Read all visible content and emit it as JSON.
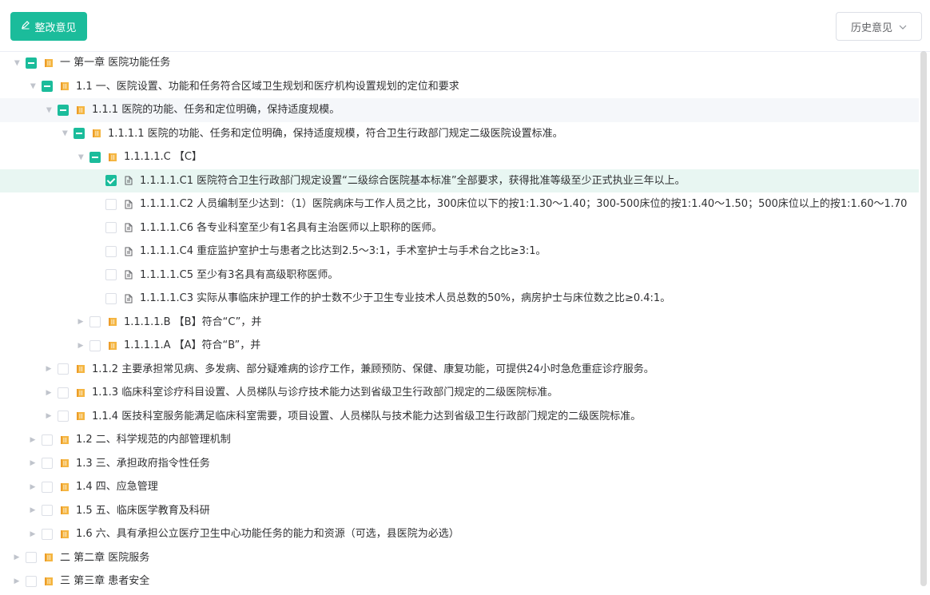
{
  "toolbar": {
    "rectify_label": "整改意见",
    "history_label": "历史意见"
  },
  "colors": {
    "primary": "#1bbc9b",
    "folder": "#f5b642"
  },
  "tree": [
    {
      "depth": 0,
      "caret": "open",
      "check": "ind",
      "icon": "folder",
      "label": "一 第一章 医院功能任务",
      "state": ""
    },
    {
      "depth": 1,
      "caret": "open",
      "check": "ind",
      "icon": "folder",
      "label": "1.1 一、医院设置、功能和任务符合区域卫生规划和医疗机构设置规划的定位和要求",
      "state": ""
    },
    {
      "depth": 2,
      "caret": "open",
      "check": "ind",
      "icon": "folder",
      "label": "1.1.1 医院的功能、任务和定位明确，保持适度规模。",
      "state": "hover"
    },
    {
      "depth": 3,
      "caret": "open",
      "check": "ind",
      "icon": "folder",
      "label": "1.1.1.1 医院的功能、任务和定位明确，保持适度规模，符合卫生行政部门规定二级医院设置标准。",
      "state": ""
    },
    {
      "depth": 4,
      "caret": "open",
      "check": "ind",
      "icon": "folder",
      "label": "1.1.1.1.C 【C】",
      "state": ""
    },
    {
      "depth": 5,
      "caret": "leaf",
      "check": "on",
      "icon": "doc",
      "label": "1.1.1.1.C1 医院符合卫生行政部门规定设置“二级综合医院基本标准”全部要求，获得批准等级至少正式执业三年以上。",
      "state": "current"
    },
    {
      "depth": 5,
      "caret": "leaf",
      "check": "off",
      "icon": "doc",
      "label": "1.1.1.1.C2 人员编制至少达到：（1）医院病床与工作人员之比，300床位以下的按1:1.30～1.40；300-500床位的按1:1.40～1.50；500床位以上的按1:1.60～1.70",
      "state": ""
    },
    {
      "depth": 5,
      "caret": "leaf",
      "check": "off",
      "icon": "doc",
      "label": "1.1.1.1.C6 各专业科室至少有1名具有主治医师以上职称的医师。",
      "state": ""
    },
    {
      "depth": 5,
      "caret": "leaf",
      "check": "off",
      "icon": "doc",
      "label": "1.1.1.1.C4 重症监护室护士与患者之比达到2.5～3:1，手术室护士与手术台之比≥3:1。",
      "state": ""
    },
    {
      "depth": 5,
      "caret": "leaf",
      "check": "off",
      "icon": "doc",
      "label": "1.1.1.1.C5 至少有3名具有高级职称医师。",
      "state": ""
    },
    {
      "depth": 5,
      "caret": "leaf",
      "check": "off",
      "icon": "doc",
      "label": "1.1.1.1.C3 实际从事临床护理工作的护士数不少于卫生专业技术人员总数的50%，病房护士与床位数之比≥0.4:1。",
      "state": ""
    },
    {
      "depth": 4,
      "caret": "closed",
      "check": "off",
      "icon": "folder",
      "label": "1.1.1.1.B 【B】符合“C”，并",
      "state": ""
    },
    {
      "depth": 4,
      "caret": "closed",
      "check": "off",
      "icon": "folder",
      "label": "1.1.1.1.A 【A】符合“B”，并",
      "state": ""
    },
    {
      "depth": 2,
      "caret": "closed",
      "check": "off",
      "icon": "folder",
      "label": "1.1.2 主要承担常见病、多发病、部分疑难病的诊疗工作，兼顾预防、保健、康复功能，可提供24小时急危重症诊疗服务。",
      "state": ""
    },
    {
      "depth": 2,
      "caret": "closed",
      "check": "off",
      "icon": "folder",
      "label": "1.1.3 临床科室诊疗科目设置、人员梯队与诊疗技术能力达到省级卫生行政部门规定的二级医院标准。",
      "state": ""
    },
    {
      "depth": 2,
      "caret": "closed",
      "check": "off",
      "icon": "folder",
      "label": "1.1.4 医技科室服务能满足临床科室需要，项目设置、人员梯队与技术能力达到省级卫生行政部门规定的二级医院标准。",
      "state": ""
    },
    {
      "depth": 1,
      "caret": "closed",
      "check": "off",
      "icon": "folder",
      "label": "1.2 二、科学规范的内部管理机制",
      "state": ""
    },
    {
      "depth": 1,
      "caret": "closed",
      "check": "off",
      "icon": "folder",
      "label": "1.3 三、承担政府指令性任务",
      "state": ""
    },
    {
      "depth": 1,
      "caret": "closed",
      "check": "off",
      "icon": "folder",
      "label": "1.4 四、应急管理",
      "state": ""
    },
    {
      "depth": 1,
      "caret": "closed",
      "check": "off",
      "icon": "folder",
      "label": "1.5 五、临床医学教育及科研",
      "state": ""
    },
    {
      "depth": 1,
      "caret": "closed",
      "check": "off",
      "icon": "folder",
      "label": "1.6 六、具有承担公立医疗卫生中心功能任务的能力和资源（可选，县医院为必选）",
      "state": ""
    },
    {
      "depth": 0,
      "caret": "closed",
      "check": "off",
      "icon": "folder",
      "label": "二 第二章 医院服务",
      "state": ""
    },
    {
      "depth": 0,
      "caret": "closed",
      "check": "off",
      "icon": "folder",
      "label": "三 第三章 患者安全",
      "state": ""
    }
  ]
}
